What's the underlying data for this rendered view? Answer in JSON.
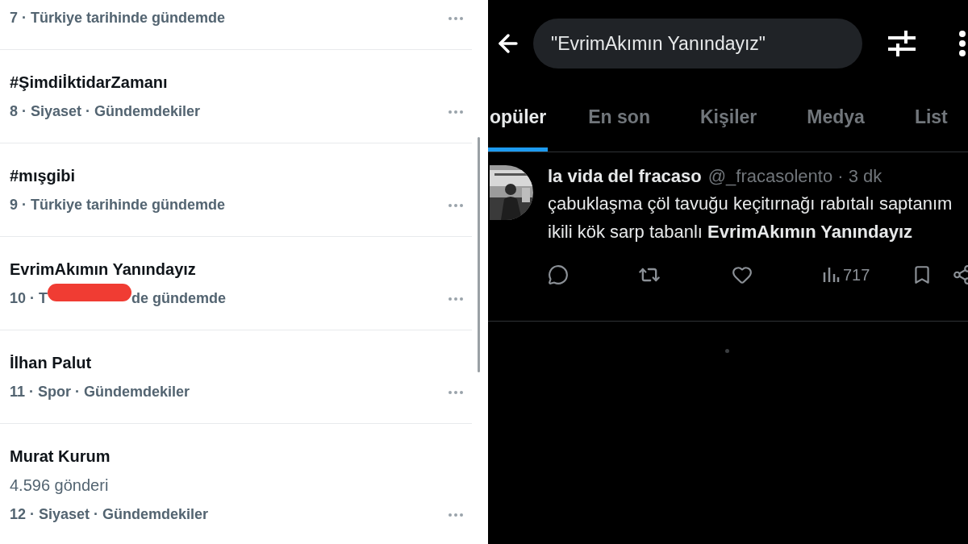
{
  "trends": {
    "rows": [
      {
        "meta": "7 · Türkiye tarihinde gündemde"
      },
      {
        "title": "#ŞimdiİktidarZamanı",
        "meta": "8 · Siyaset · Gündemdekiler"
      },
      {
        "title": "#mışgibi",
        "meta": "9 · Türkiye tarihinde gündemde"
      },
      {
        "title": "EvrimAkımın Yanındayız",
        "meta_parts": [
          "10 · T",
          "de gündemde"
        ]
      },
      {
        "title": "İlhan Palut",
        "meta": "11 · Spor · Gündemdekiler"
      },
      {
        "title": "Murat Kurum",
        "posts": "4.596 gönderi",
        "meta": "12 · Siyaset · Gündemdekiler"
      }
    ]
  },
  "search": {
    "query": "\"EvrimAkımın Yanındayız\""
  },
  "tabs": [
    {
      "label": "opüler",
      "selected": true
    },
    {
      "label": "En son",
      "selected": false
    },
    {
      "label": "Kişiler",
      "selected": false
    },
    {
      "label": "Medya",
      "selected": false
    },
    {
      "label": "List",
      "selected": false
    }
  ],
  "tweet": {
    "name": "la vida del fracaso",
    "handle": "@_fracasolento · 3 dk",
    "text": "çabuklaşma çöl tavuğu keçitırnağı rabıtalı saptanım ikili kök sarp tabanlı **EvrimAkımın Yanındayız**",
    "views": "717"
  }
}
